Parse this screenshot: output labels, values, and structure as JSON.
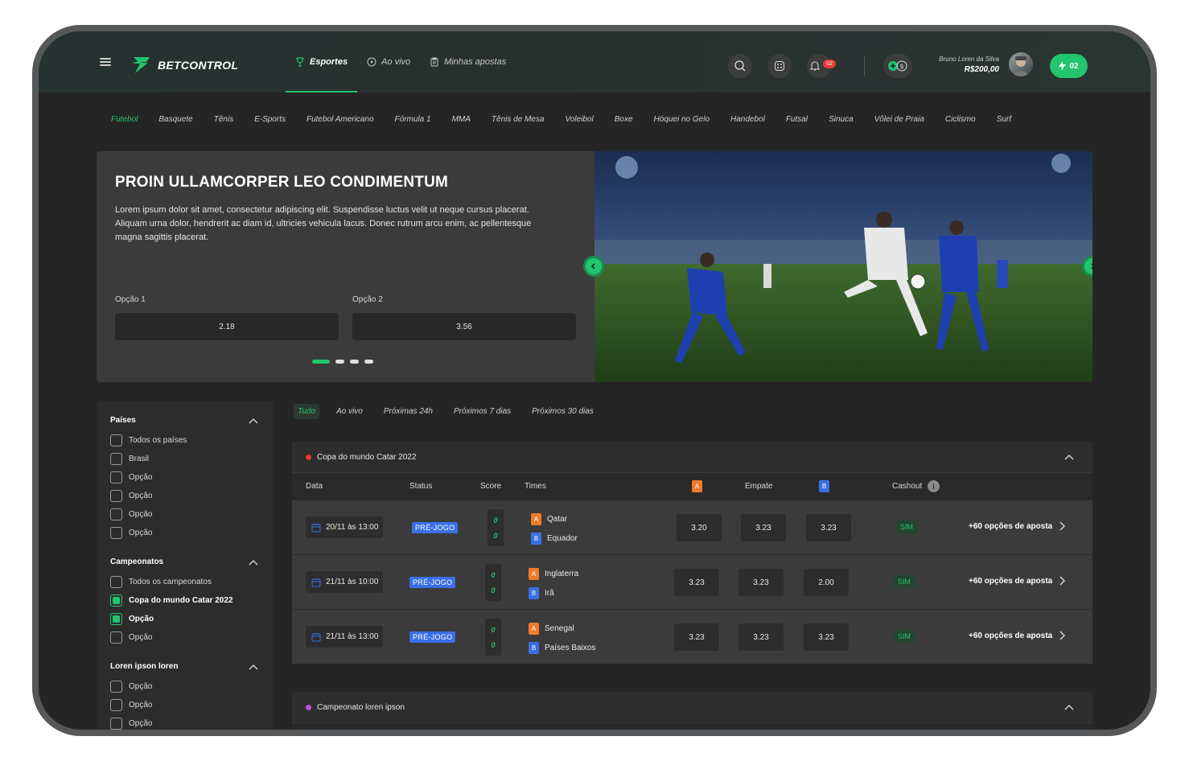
{
  "brand": {
    "name": "BETCONTROL",
    "accent": "#22c46d"
  },
  "nav": [
    {
      "label": "Esportes",
      "icon": "trophy-icon",
      "active": true
    },
    {
      "label": "Ao vivo",
      "icon": "play-icon",
      "active": false
    },
    {
      "label": "Minhas apostas",
      "icon": "clipboard-icon",
      "active": false
    }
  ],
  "header": {
    "notifications_count": "02",
    "user_name": "Bruno Loren da Silva",
    "user_balance": "R$200,00",
    "bolt_count": "02"
  },
  "sports": [
    "Futebol",
    "Basquete",
    "Tênis",
    "E-Sports",
    "Futebol Americano",
    "Fórmula 1",
    "MMA",
    "Tênis de Mesa",
    "Voleibol",
    "Boxe",
    "Hóquei no Gelo",
    "Handebol",
    "Futsal",
    "Sinuca",
    "Vôlei de Praia",
    "Ciclismo",
    "Surf"
  ],
  "hero": {
    "title": "PROIN ULLAMCORPER LEO CONDIMENTUM",
    "description": "Lorem ipsum dolor sit amet, consectetur adipiscing elit. Suspendisse luctus velit ut neque cursus placerat. Aliquam urna dolor, hendrerit ac diam id, ultricies vehicula lacus. Donec rutrum arcu enim, ac pellentesque magna sagittis placerat.",
    "option1_label": "Opção 1",
    "option1_value": "2.18",
    "option2_label": "Opção 2",
    "option2_value": "3.56"
  },
  "sidebar": {
    "countries_title": "Países",
    "countries": [
      {
        "label": "Todos os países",
        "checked": false
      },
      {
        "label": "Brasil",
        "checked": false
      },
      {
        "label": "Opção",
        "checked": false
      },
      {
        "label": "Opção",
        "checked": false
      },
      {
        "label": "Opção",
        "checked": false
      },
      {
        "label": "Opção",
        "checked": false
      }
    ],
    "championships_title": "Campeonatos",
    "championships": [
      {
        "label": "Todos os campeonatos",
        "checked": false
      },
      {
        "label": "Copa do mundo Catar 2022",
        "checked": true
      },
      {
        "label": "Opção",
        "checked": true
      },
      {
        "label": "Opção",
        "checked": false
      }
    ],
    "other_title": "Loren ipson loren",
    "other": [
      {
        "label": "Opção",
        "checked": false
      },
      {
        "label": "Opção",
        "checked": false
      },
      {
        "label": "Opção",
        "checked": false
      }
    ]
  },
  "filters": [
    "Tudo",
    "Ao vivo",
    "Próximas 24h",
    "Próximos 7 dias",
    "Próximos 30 dias"
  ],
  "table_headers": {
    "date": "Data",
    "status": "Status",
    "score": "Score",
    "teams": "Times",
    "team_a": "A",
    "draw": "Empate",
    "team_b": "B",
    "cashout": "Cashout",
    "info": "i"
  },
  "competitions": [
    {
      "name": "Copa do mundo Catar 2022",
      "dot_color": "#e53935",
      "matches": [
        {
          "date": "20/11 às 13:00",
          "status": "PRÉ-JOGO",
          "score_a": "0",
          "score_b": "0",
          "team_a": "Qatar",
          "team_b": "Equador",
          "odd_a": "3.20",
          "odd_draw": "3.23",
          "odd_b": "3.23",
          "cashout": "SIM",
          "more": "+60 opções de aposta"
        },
        {
          "date": "21/11 às 10:00",
          "status": "PRÉ-JOGO",
          "score_a": "0",
          "score_b": "0",
          "team_a": "Inglaterra",
          "team_b": "Irã",
          "odd_a": "3.23",
          "odd_draw": "3.23",
          "odd_b": "2.00",
          "cashout": "SIM",
          "more": "+60 opções de aposta"
        },
        {
          "date": "21/11 às 13:00",
          "status": "PRÉ-JOGO",
          "score_a": "0",
          "score_b": "0",
          "team_a": "Senegal",
          "team_b": "Países Baixos",
          "odd_a": "3.23",
          "odd_draw": "3.23",
          "odd_b": "3.23",
          "cashout": "SIM",
          "more": "+60 opções de aposta"
        }
      ]
    },
    {
      "name": "Campeonato loren ipson",
      "dot_color": "#c04ddb"
    }
  ],
  "tag_letters": {
    "a": "A",
    "b": "B"
  }
}
